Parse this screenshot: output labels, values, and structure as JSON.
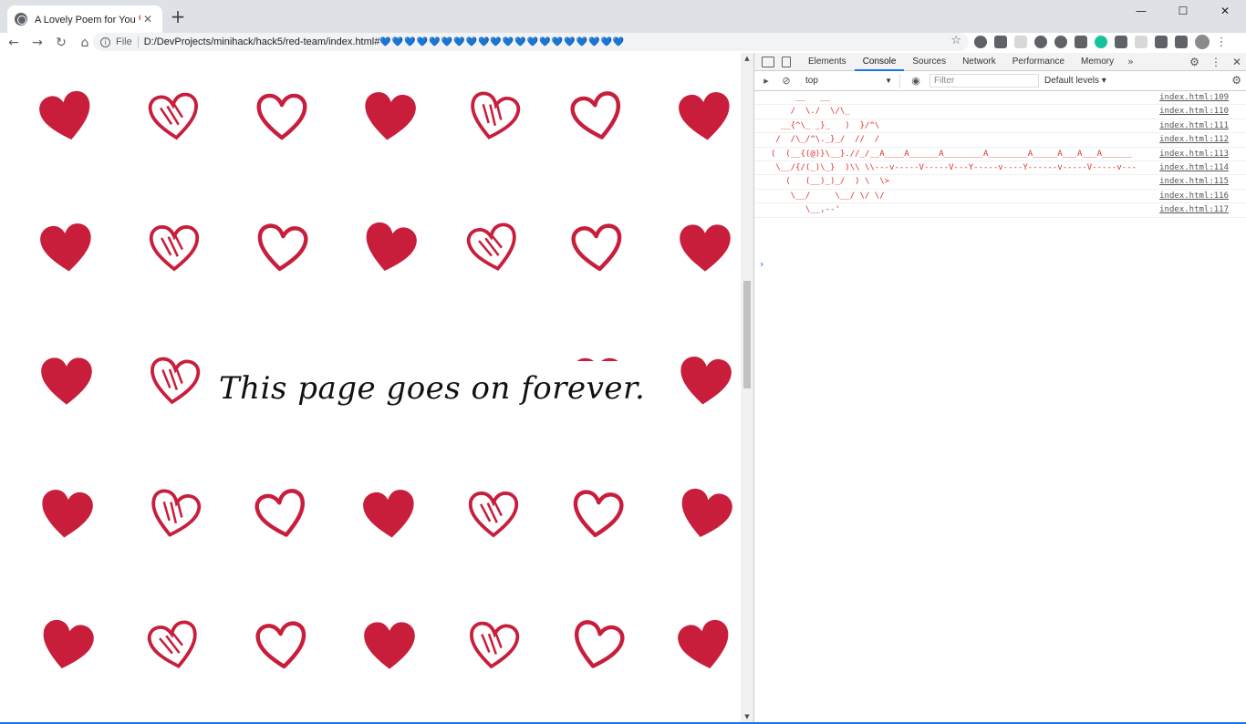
{
  "browser": {
    "tab_title": "A Lovely Poem for You",
    "tab_heart": "❤️",
    "tab_close": "✕",
    "new_tab": "+",
    "window_controls": {
      "minimize": "—",
      "maximize": "☐",
      "close": "✕"
    },
    "nav": {
      "back": "←",
      "forward": "→",
      "reload": "↻",
      "home": "⌂"
    },
    "scheme": "File",
    "url": "D:/DevProjects/minihack/hack5/red-team/index.html#",
    "url_hearts": "💙💙💙💙💙💙💙💙💙💙💙💙💙💙💙💙💙💙💙💙",
    "star": "☆",
    "menu": "⋮",
    "icons": [
      "info-icon",
      "star-icon",
      "extensions-puzzle-icon",
      "profile-avatar-icon"
    ]
  },
  "page": {
    "tagline": "This page goes on forever.",
    "heart_color": "#c81e3c"
  },
  "devtools": {
    "tabs": [
      "Elements",
      "Console",
      "Sources",
      "Network",
      "Performance",
      "Memory"
    ],
    "active_tab": "Console",
    "more": "»",
    "context": "top",
    "context_arrow": "▼",
    "filter_placeholder": "Filter",
    "levels": "Default levels ▾",
    "logs": [
      {
        "msg": "     __   __",
        "src": "index.html:109"
      },
      {
        "msg": "    /  \\./  \\/\\_",
        "src": "index.html:110"
      },
      {
        "msg": "  __{^\\_ _}_   )  }/^\\",
        "src": "index.html:111"
      },
      {
        "msg": " /  /\\_/^\\._}_/  //  /",
        "src": "index.html:112"
      },
      {
        "msg": "(  (__{(@)}\\__}.//_/__A____A______A________A________A_____A___A___A______",
        "src": "index.html:113"
      },
      {
        "msg": " \\__/{/(_)\\_}  )\\\\ \\\\---v-----V-----V---Y-----v----Y------v-----V-----v---",
        "src": "index.html:114"
      },
      {
        "msg": "   (   (__)_)_/  ) \\  \\>",
        "src": "index.html:115"
      },
      {
        "msg": "    \\__/     \\__/ \\/ \\/",
        "src": "index.html:116"
      },
      {
        "msg": "       \\__,--'",
        "src": "index.html:117"
      }
    ],
    "prompt": "›"
  }
}
